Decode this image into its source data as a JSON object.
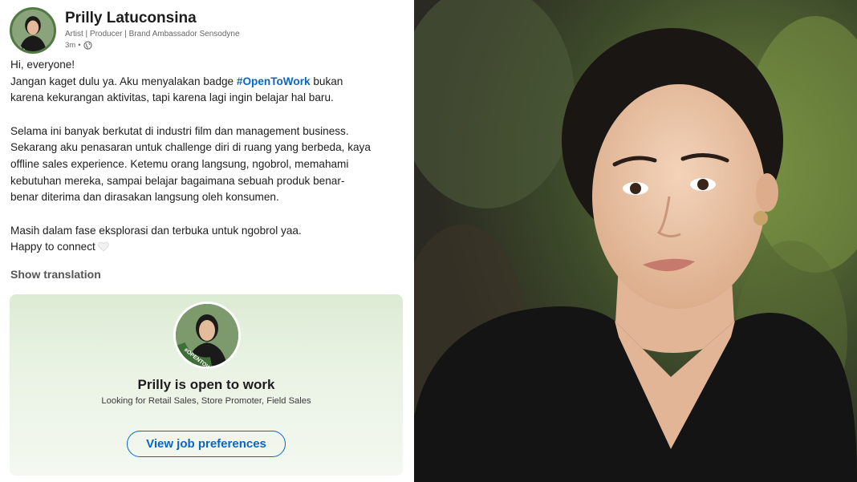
{
  "post": {
    "author_name": "Prilly Latuconsina",
    "headline": "Artist | Producer | Brand Ambassador Sensodyne",
    "time": "3m",
    "separator": "•",
    "avatar_badge": "#OPENTOWORK",
    "body": {
      "greeting": "Hi, everyone!",
      "line1_before": "Jangan kaget dulu ya. Aku menyalakan badge ",
      "hashtag": "#OpenToWork",
      "line1_after": " bukan\nkarena kekurangan aktivitas, tapi karena lagi ingin belajar hal baru.",
      "para2": "Selama ini banyak berkutat di industri film dan management business.\nSekarang aku penasaran untuk challenge diri di ruang yang berbeda, kaya\noffline sales experience. Ketemu orang langsung, ngobrol, memahami\nkebutuhan mereka, sampai belajar bagaimana sebuah produk benar-\nbenar diterima dan dirasakan langsung oleh konsumen.",
      "para3": "Masih dalam fase eksplorasi dan terbuka untuk ngobrol yaa.",
      "closing": "Happy to connect"
    },
    "show_translation": "Show translation",
    "open_to_work": {
      "title": "Prilly is open to work",
      "subtitle": "Looking for Retail Sales, Store Promoter, Field Sales",
      "button": "View job preferences",
      "avatar_badge": "#OPENTOWORK"
    }
  },
  "colors": {
    "link": "#0a66c2",
    "otw_green": "#4f7a43",
    "card_bg": "#e3efdc"
  },
  "icons": {
    "globe": "globe-icon",
    "heart": "white-heart-icon"
  }
}
